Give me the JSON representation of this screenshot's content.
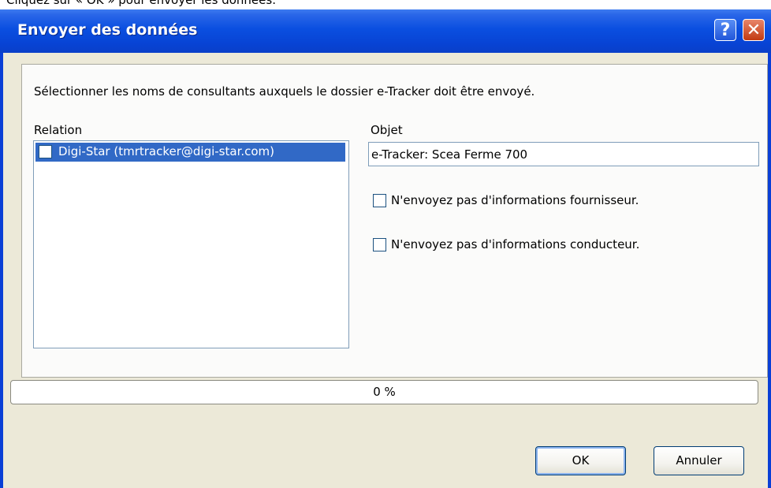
{
  "caption": "Cliquez sur « OK » pour envoyer les données.",
  "window": {
    "title": "Envoyer des données"
  },
  "titlebar_buttons": {
    "help": "?",
    "close": "✕"
  },
  "instruction": "Sélectionner les noms de consultants auxquels le dossier e-Tracker doit être envoyé.",
  "relation": {
    "label": "Relation",
    "items": [
      {
        "text": "Digi-Star (tmrtracker@digi-star.com)",
        "checked": false,
        "selected": true
      }
    ]
  },
  "subject": {
    "label": "Objet",
    "value": "e-Tracker: Scea Ferme 700"
  },
  "options": [
    {
      "label": "N'envoyez pas d'informations fournisseur.",
      "checked": false
    },
    {
      "label": "N'envoyez pas d'informations conducteur.",
      "checked": false
    }
  ],
  "progress": {
    "percent": 0,
    "text": "0 %"
  },
  "buttons": {
    "ok": "OK",
    "cancel": "Annuler"
  },
  "colors": {
    "titlebar": "#0843d4",
    "selection": "#3169c6",
    "client_bg": "#ece9d8"
  }
}
